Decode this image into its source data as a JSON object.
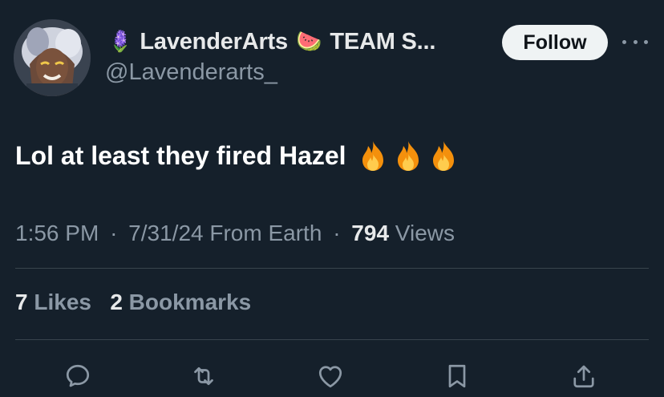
{
  "author": {
    "name_emoji": "🪻",
    "display_name": "LavenderArts",
    "team_emoji": "🍉",
    "team_text": "TEAM S...",
    "handle": "@Lavenderarts_"
  },
  "follow_label": "Follow",
  "tweet": {
    "text": "Lol at least they fired Hazel",
    "emoji_count": 3,
    "emoji_name": "fire"
  },
  "meta": {
    "time": "1:56 PM",
    "separator": "·",
    "date": "7/31/24",
    "source": "From Earth",
    "views_count": "794",
    "views_label": "Views"
  },
  "stats": {
    "likes_count": "7",
    "likes_label": "Likes",
    "bookmarks_count": "2",
    "bookmarks_label": "Bookmarks"
  },
  "actions": [
    {
      "name": "reply",
      "icon": "reply-icon"
    },
    {
      "name": "retweet",
      "icon": "retweet-icon"
    },
    {
      "name": "like",
      "icon": "heart-icon"
    },
    {
      "name": "bookmark",
      "icon": "bookmark-icon"
    },
    {
      "name": "share",
      "icon": "share-icon"
    }
  ],
  "colors": {
    "background": "#15202b",
    "primary_text": "#e7e9ea",
    "secondary_text": "#8b98a5",
    "divider": "#38444d",
    "follow_bg": "#eff3f4"
  }
}
